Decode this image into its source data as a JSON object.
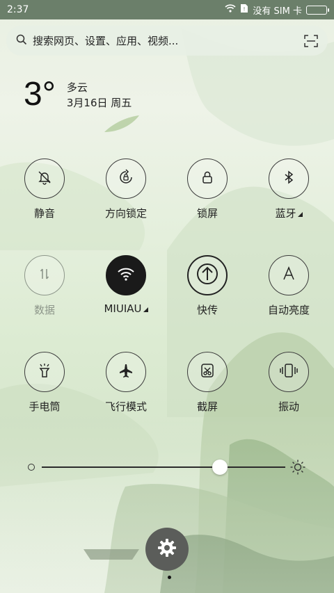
{
  "status_bar": {
    "time": "2:37",
    "carrier": "没有 SIM 卡"
  },
  "search": {
    "placeholder": "搜索网页、设置、应用、视频..."
  },
  "weather": {
    "temperature": "3°",
    "condition": "多云",
    "date": "3月16日 周五"
  },
  "toggles": [
    {
      "label": "静音",
      "icon": "bell-off-icon",
      "state": "off"
    },
    {
      "label": "方向锁定",
      "icon": "rotation-lock-icon",
      "state": "off"
    },
    {
      "label": "锁屏",
      "icon": "lock-icon",
      "state": "off"
    },
    {
      "label": "蓝牙",
      "icon": "bluetooth-icon",
      "state": "off"
    },
    {
      "label": "数据",
      "icon": "mobile-data-icon",
      "state": "disabled"
    },
    {
      "label": "MIUIAU",
      "icon": "wifi-icon",
      "state": "on"
    },
    {
      "label": "快传",
      "icon": "upload-icon",
      "state": "off"
    },
    {
      "label": "自动亮度",
      "icon": "auto-brightness-icon",
      "state": "off"
    },
    {
      "label": "手电筒",
      "icon": "flashlight-icon",
      "state": "off"
    },
    {
      "label": "飞行模式",
      "icon": "airplane-icon",
      "state": "off"
    },
    {
      "label": "截屏",
      "icon": "screenshot-icon",
      "state": "off"
    },
    {
      "label": "振动",
      "icon": "vibrate-icon",
      "state": "off"
    }
  ],
  "brightness": {
    "level": 0.73
  },
  "colors": {
    "active_toggle": "#1a1a1a",
    "status_bar": "#6b7f6a",
    "settings_button": "#5b5d5a"
  }
}
